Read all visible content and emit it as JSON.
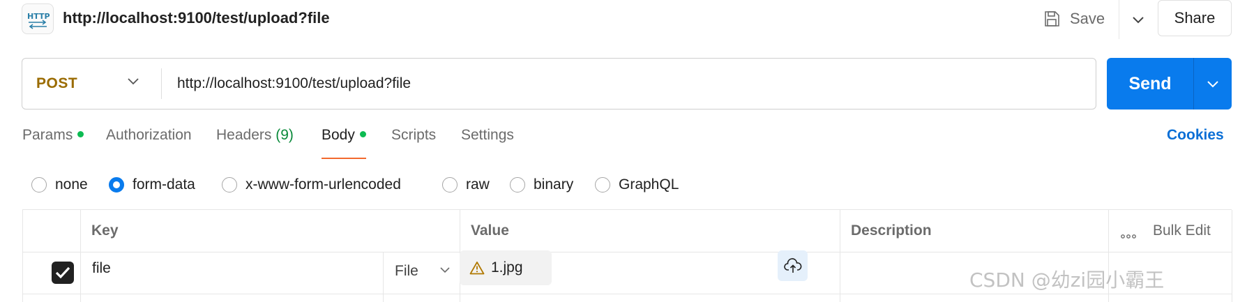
{
  "header": {
    "title": "http://localhost:9100/test/upload?file",
    "save_label": "Save",
    "share_label": "Share",
    "icon": "http-icon"
  },
  "request": {
    "method": "POST",
    "url": "http://localhost:9100/test/upload?file",
    "send_label": "Send"
  },
  "tabs": [
    {
      "label": "Params",
      "dot": true
    },
    {
      "label": "Authorization"
    },
    {
      "label": "Headers",
      "count": "(9)"
    },
    {
      "label": "Body",
      "dot": true,
      "active": true
    },
    {
      "label": "Scripts"
    },
    {
      "label": "Settings"
    }
  ],
  "cookies_label": "Cookies",
  "body_modes": [
    {
      "label": "none",
      "checked": false
    },
    {
      "label": "form-data",
      "checked": true
    },
    {
      "label": "x-www-form-urlencoded",
      "checked": false
    },
    {
      "label": "raw",
      "checked": false
    },
    {
      "label": "binary",
      "checked": false
    },
    {
      "label": "GraphQL",
      "checked": false
    }
  ],
  "table": {
    "headers": {
      "key": "Key",
      "value": "Value",
      "description": "Description"
    },
    "bulk_edit_label": "Bulk Edit",
    "rows": [
      {
        "checked": true,
        "key": "file",
        "type": "File",
        "value_file": "1.jpg",
        "warning_icon": "warning-icon",
        "description": ""
      }
    ]
  },
  "watermark": "CSDN @幼zi园小霸王",
  "colors": {
    "method_post": "#9a6b00",
    "send_button": "#097bed",
    "active_tab_underline": "#f2692e",
    "status_dot": "#0cbb52",
    "link": "#0a6fd6"
  }
}
